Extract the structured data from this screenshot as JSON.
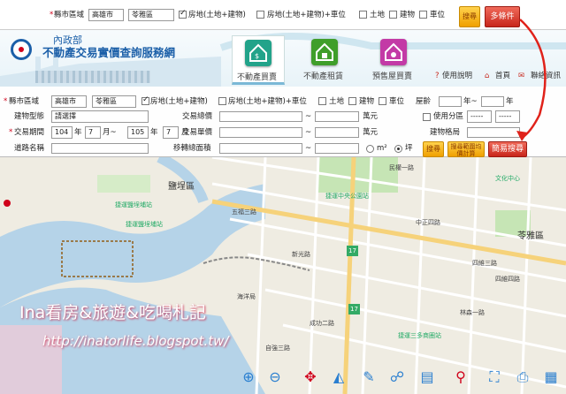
{
  "top_bar": {
    "county_label": "縣市區域",
    "county_value": "高雄市",
    "district_value": "苓雅區",
    "types": [
      "房地(土地+建物)",
      "房地(土地+建物)+車位",
      "土地",
      "建物",
      "車位"
    ],
    "search_btn": "搜尋",
    "multi_btn": "多條件"
  },
  "header": {
    "ministry": "內政部",
    "site_title": "不動產交易實價查詢服務網",
    "nav": [
      "不動產買賣",
      "不動產租賃",
      "預售屋買賣"
    ],
    "links": [
      "使用說明",
      "首頁",
      "聯絡資訊"
    ]
  },
  "form": {
    "county_label": "縣市區域",
    "county_value": "高雄市",
    "district_value": "苓雅區",
    "types": [
      "房地(土地+建物)",
      "房地(土地+建物)+車位",
      "土地",
      "建物",
      "車位"
    ],
    "age_label": "屋齡",
    "age_sep": "年~",
    "age_unit": "年",
    "building_type_label": "建物型態",
    "building_type_value": "請選擇",
    "total_price_label": "交易總價",
    "total_price_unit": "萬元",
    "use_zone_label": "使用分區",
    "use_zone_value1": "-----",
    "use_zone_value2": "-----",
    "period_label": "交易期間",
    "period_from_year": "104",
    "period_from_month": "7",
    "period_to_year": "105",
    "period_to_month": "7",
    "year_unit": "年",
    "month_to": "月~",
    "month_unit": "月",
    "unit_price_label": "交易單價",
    "unit_price_unit": "萬元",
    "layout_label": "建物格局",
    "road_label": "道路名稱",
    "transfer_area_label": "移轉總面積",
    "area_unit_m2": "m²",
    "area_unit_ping": "坪",
    "range_sep": "~",
    "search_btn": "搜尋",
    "range_btn": "搜尋範圍均價計算",
    "simple_btn": "簡易搜尋"
  },
  "map": {
    "labels": [
      "鹽埕區",
      "捷運鹽埕埔站",
      "五福三路",
      "捷運中央公園站",
      "中正四路",
      "四維三路",
      "四維四路",
      "苓雅區",
      "捷運三多商圈站",
      "海洋局",
      "捷運鹽埕埔站",
      "新光路",
      "自強三路",
      "成功二路",
      "民權一路",
      "林森一路",
      "文化中心",
      "17",
      "17"
    ],
    "watermark_line1": "Ina看房&旅遊&吃喝札記",
    "watermark_line2": "http://inatorlife.blogspot.tw/"
  },
  "toolbar": [
    "zoom-in-icon",
    "zoom-out-icon",
    "pan-icon",
    "measure-area-icon",
    "draw-icon",
    "locate-icon",
    "ruler-icon",
    "pin-icon",
    "full-extent-icon",
    "print-icon"
  ],
  "colors": {
    "accent_red": "#c8261b",
    "accent_yellow": "#f0a000",
    "brand_blue": "#1b5fa8"
  }
}
